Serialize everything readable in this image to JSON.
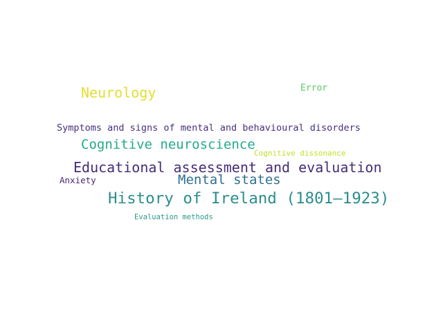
{
  "words": [
    {
      "text": "Neurology",
      "color": "#e3de2f"
    },
    {
      "text": "Error",
      "color": "#5ec962"
    },
    {
      "text": "Symptoms and signs of mental and behavioural disorders",
      "color": "#46307e"
    },
    {
      "text": "Cognitive neuroscience",
      "color": "#26a88a"
    },
    {
      "text": "Cognitive dissonance",
      "color": "#c2df23"
    },
    {
      "text": "Educational assessment and evaluation",
      "color": "#472c7a"
    },
    {
      "text": "Anxiety",
      "color": "#482878"
    },
    {
      "text": "Mental states",
      "color": "#2e6f8e"
    },
    {
      "text": "History of Ireland (1801–1923)",
      "color": "#2c8e8c"
    },
    {
      "text": "Evaluation methods",
      "color": "#2a9a89"
    }
  ]
}
